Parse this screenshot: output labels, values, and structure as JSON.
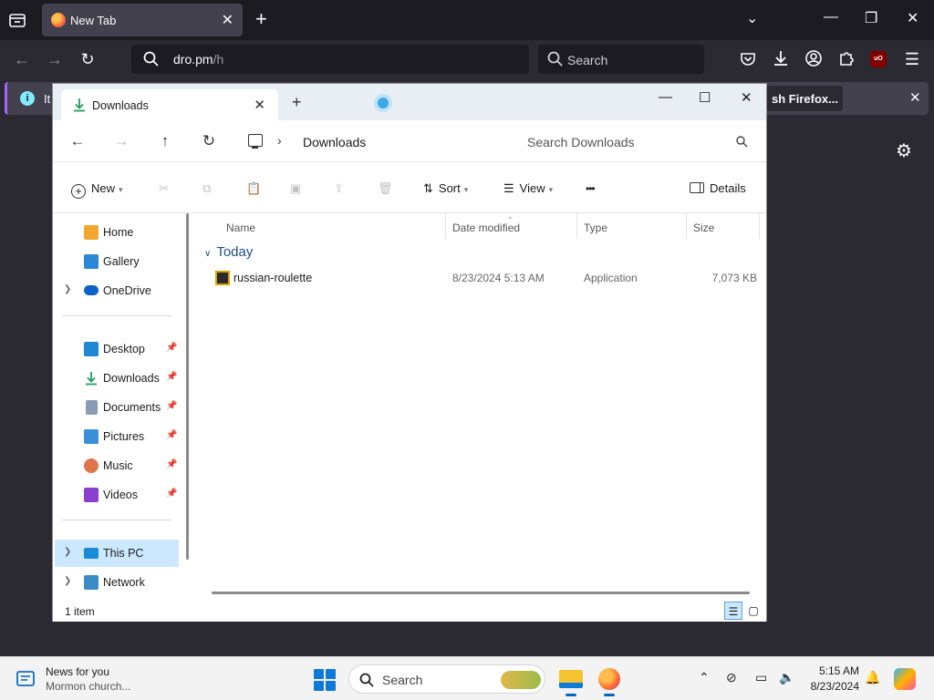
{
  "firefox": {
    "tab_title": "New Tab",
    "url_main": "dro.pm",
    "url_path": "/h",
    "search_placeholder": "Search",
    "notice_text": "It",
    "notice_button": "sh Firefox..."
  },
  "explorer": {
    "tab_title": "Downloads",
    "breadcrumb": "Downloads",
    "search_placeholder": "Search Downloads",
    "toolbar": {
      "new_label": "New",
      "sort_label": "Sort",
      "view_label": "View",
      "more_label": "•••",
      "details_label": "Details"
    },
    "nav": {
      "top": [
        {
          "label": "Home",
          "icon": "home-icon"
        },
        {
          "label": "Gallery",
          "icon": "gallery-icon"
        },
        {
          "label": "OneDrive",
          "icon": "onedrive-icon"
        }
      ],
      "pinned": [
        {
          "label": "Desktop",
          "icon": "desktop-icon"
        },
        {
          "label": "Downloads",
          "icon": "downloads-icon"
        },
        {
          "label": "Documents",
          "icon": "documents-icon"
        },
        {
          "label": "Pictures",
          "icon": "pictures-icon"
        },
        {
          "label": "Music",
          "icon": "music-icon"
        },
        {
          "label": "Videos",
          "icon": "videos-icon"
        }
      ],
      "bottom": [
        {
          "label": "This PC",
          "icon": "this-pc-icon"
        },
        {
          "label": "Network",
          "icon": "network-icon"
        }
      ]
    },
    "columns": {
      "name": "Name",
      "date": "Date modified",
      "type": "Type",
      "size": "Size"
    },
    "group_label": "Today",
    "files": [
      {
        "name": "russian-roulette",
        "date": "8/23/2024 5:13 AM",
        "type": "Application",
        "size": "7,073 KB"
      }
    ],
    "status": "1 item"
  },
  "taskbar": {
    "news_title": "News for you",
    "news_sub": "Mormon church...",
    "search_placeholder": "Search",
    "time": "5:15 AM",
    "date": "8/23/2024"
  },
  "colors": {
    "accent": "#0067c0",
    "selection": "#cce8ff",
    "firefox_dark": "#2b2a33"
  }
}
